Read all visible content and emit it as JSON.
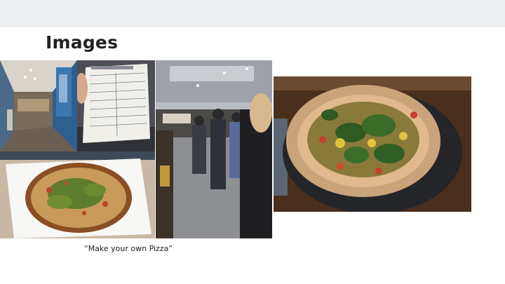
{
  "slide": {
    "title": "Images",
    "caption": "“Make your own Pizza”"
  },
  "photos": [
    {
      "id": "hallway",
      "subject": "restaurant corridor with counter"
    },
    {
      "id": "menu",
      "subject": "hand holding pizza order form"
    },
    {
      "id": "pizza-small",
      "subject": "pizza with pesto on white box"
    },
    {
      "id": "queue",
      "subject": "people queueing in restaurant"
    },
    {
      "id": "pizza-large",
      "subject": "pizza topped with spinach and peppers"
    }
  ],
  "colors": {
    "top_band": "#eceeef",
    "title_text": "#222222",
    "background": "#ffffff"
  }
}
